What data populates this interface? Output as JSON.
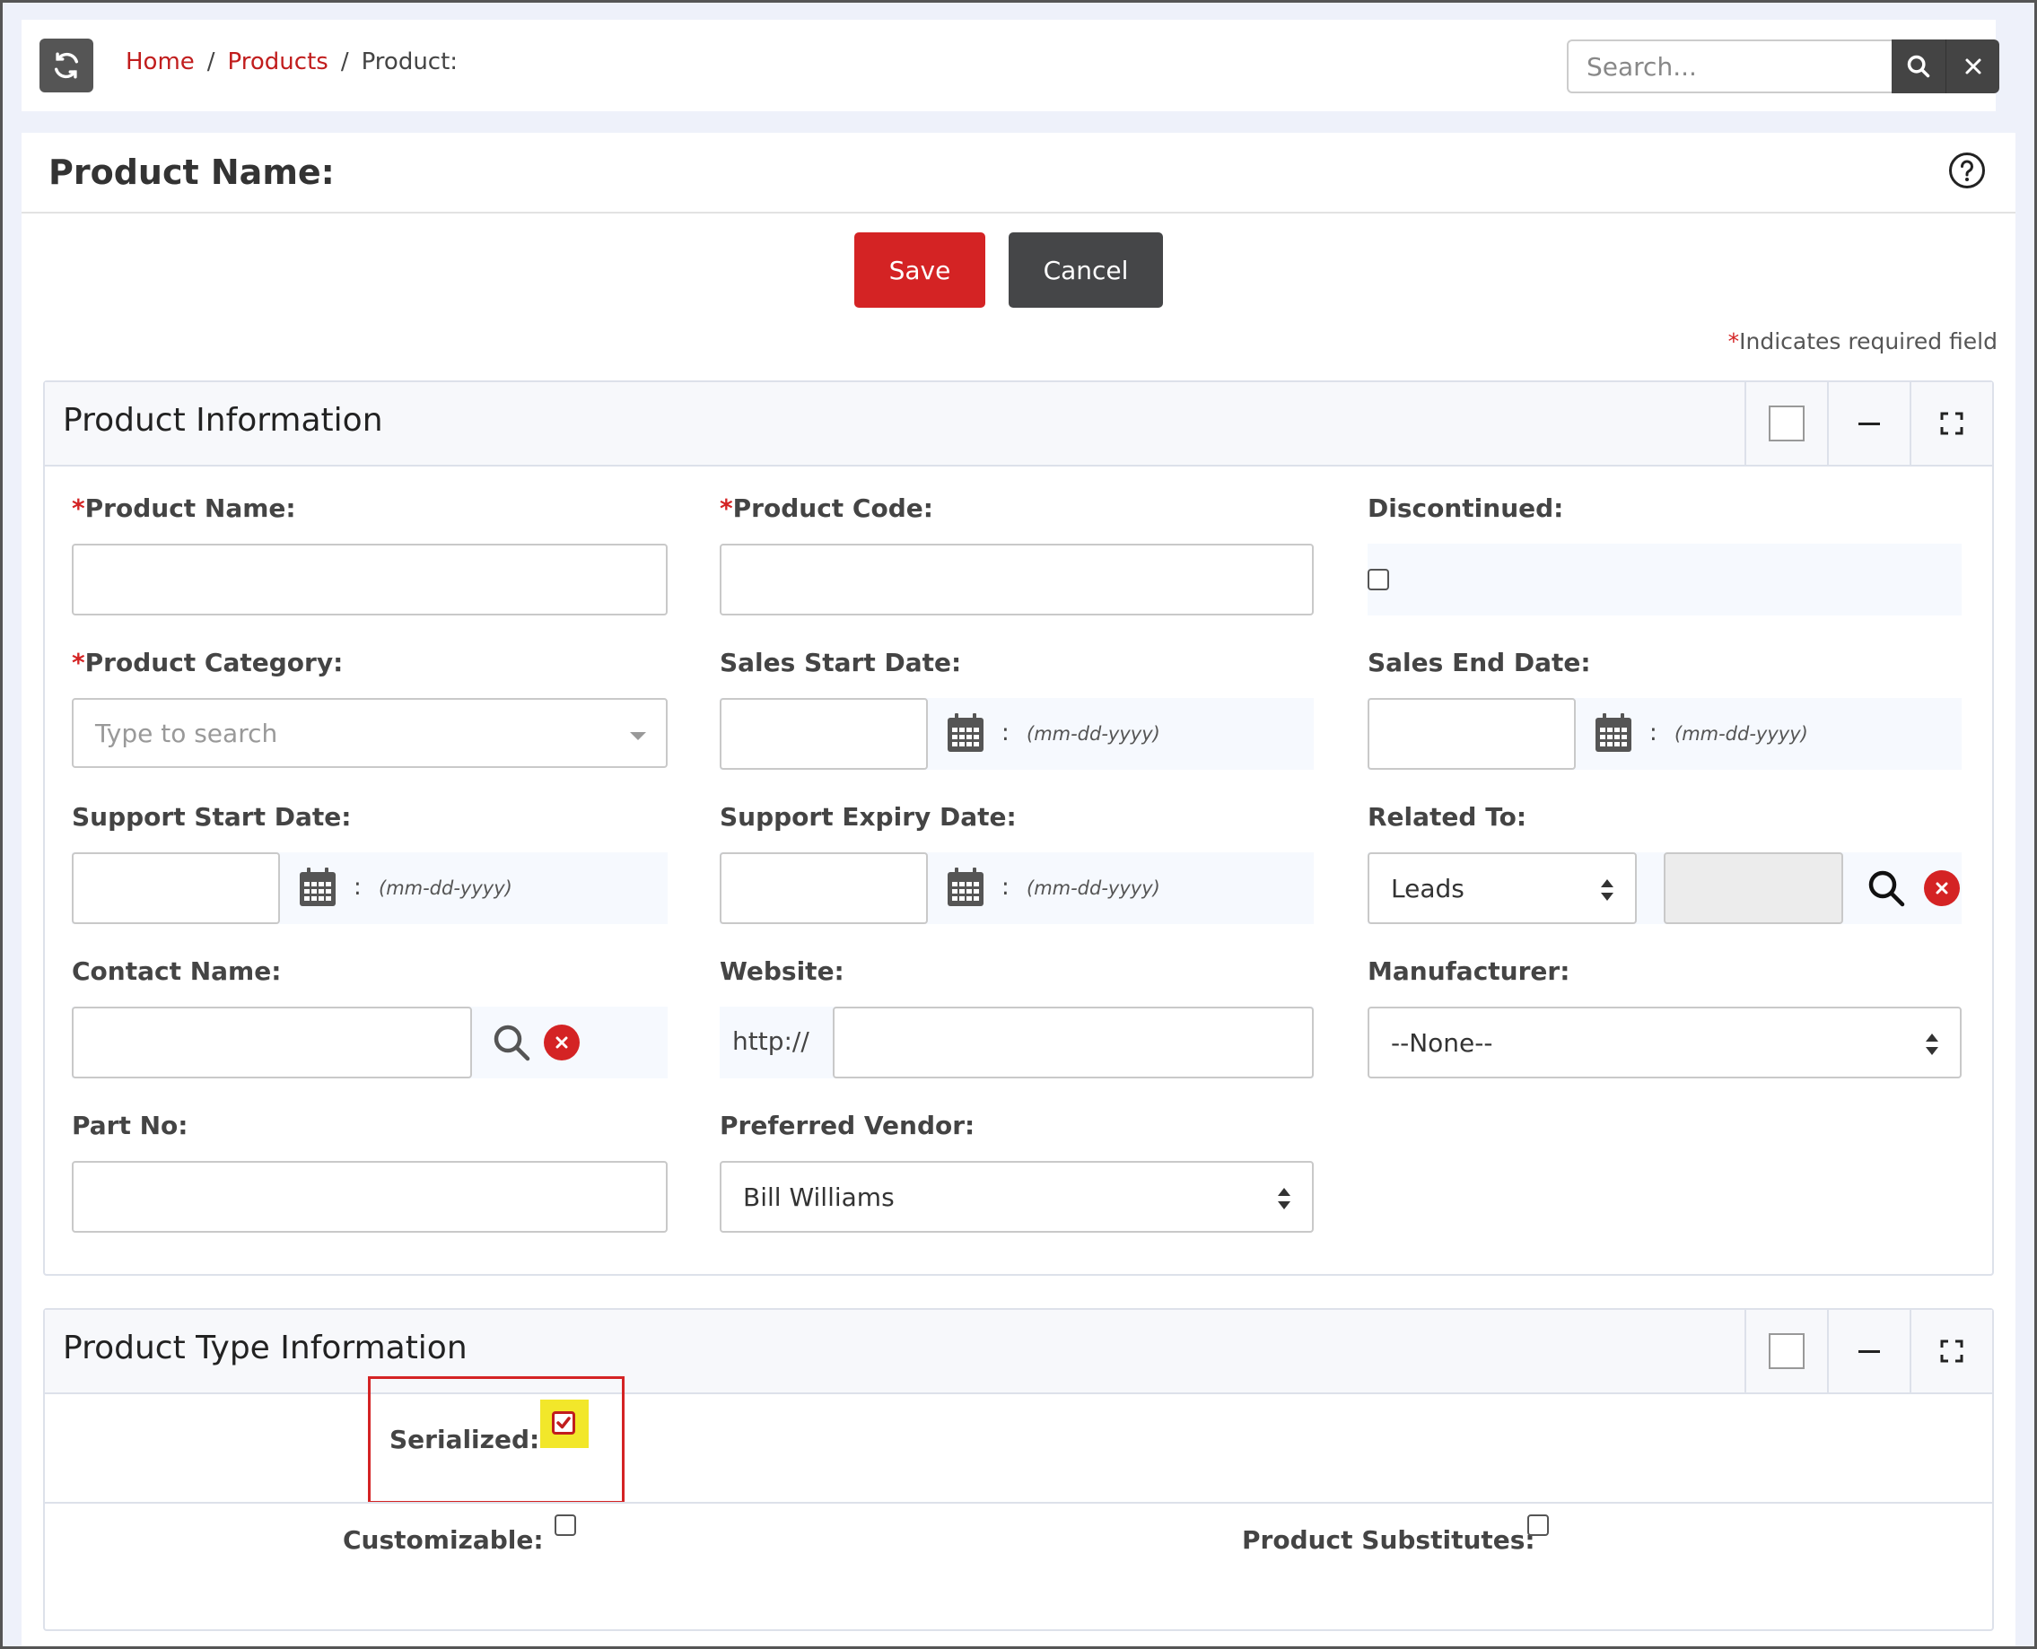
{
  "breadcrumb": {
    "home": "Home",
    "products": "Products",
    "current": "Product:",
    "sep": "/"
  },
  "search": {
    "placeholder": "Search..."
  },
  "page": {
    "title": "Product Name:"
  },
  "actions": {
    "save": "Save",
    "cancel": "Cancel"
  },
  "required_note": {
    "star": "*",
    "text": "Indicates required field"
  },
  "product_info": {
    "title": "Product Information",
    "product_name_label": "Product Name:",
    "product_code_label": "Product Code:",
    "discontinued_label": "Discontinued:",
    "product_category_label": "Product Category:",
    "product_category_placeholder": "Type to search",
    "sales_start_label": "Sales Start Date:",
    "sales_end_label": "Sales End Date:",
    "support_start_label": "Support Start Date:",
    "support_expiry_label": "Support Expiry Date:",
    "related_to_label": "Related To:",
    "related_to_value": "Leads",
    "contact_name_label": "Contact Name:",
    "website_label": "Website:",
    "website_prefix": "http://",
    "manufacturer_label": "Manufacturer:",
    "manufacturer_value": "--None--",
    "part_no_label": "Part No:",
    "preferred_vendor_label": "Preferred Vendor:",
    "preferred_vendor_value": "Bill Williams",
    "date_format": "(mm-dd-yyyy)",
    "colon": ":"
  },
  "product_type": {
    "title": "Product Type Information",
    "serialized_label": "Serialized:",
    "serialized_checked": true,
    "customizable_label": "Customizable:",
    "substitutes_label": "Product Substitutes:"
  },
  "colors": {
    "accent_red": "#d42324",
    "dark_button": "#454648",
    "highlight_yellow": "#f2e72a"
  }
}
